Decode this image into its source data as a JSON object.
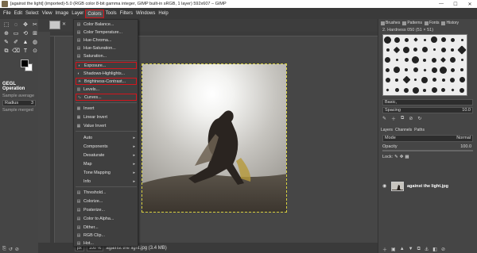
{
  "window": {
    "title": "[against the light] (imported)-5.0 (RGB color 8-bit gamma integer, GIMP built-in sRGB, 1 layer) 592x607 – GIMP",
    "controls": [
      "—",
      "☐",
      "✕"
    ]
  },
  "menubar": {
    "items": [
      "File",
      "Edit",
      "Select",
      "View",
      "Image",
      "Layer",
      "Colors",
      "Tools",
      "Filters",
      "Windows",
      "Help"
    ],
    "active": "Colors"
  },
  "colors_menu": {
    "items": [
      {
        "label": "Color Balance...",
        "icon": "▤",
        "highlighted": false
      },
      {
        "label": "Color Temperature...",
        "icon": "▤",
        "highlighted": false
      },
      {
        "label": "Hue-Chroma...",
        "icon": "▤",
        "highlighted": false
      },
      {
        "label": "Hue-Saturation...",
        "icon": "▤",
        "highlighted": false
      },
      {
        "label": "Saturation...",
        "icon": "▤",
        "highlighted": false
      },
      {
        "label": "Exposure...",
        "icon": "◐",
        "highlighted": true
      },
      {
        "label": "Shadows-Highlights...",
        "icon": "◐",
        "highlighted": false
      },
      {
        "label": "Brightness-Contrast...",
        "icon": "☀",
        "highlighted": true
      },
      {
        "label": "Levels...",
        "icon": "▥",
        "highlighted": false
      },
      {
        "label": "Curves...",
        "icon": "∿",
        "highlighted": true
      },
      {
        "label": "Invert",
        "icon": "▦",
        "highlighted": false
      },
      {
        "label": "Linear Invert",
        "icon": "▦",
        "highlighted": false
      },
      {
        "label": "Value Invert",
        "icon": "▦",
        "highlighted": false
      },
      {
        "label": "Auto",
        "icon": "",
        "submenu": true
      },
      {
        "label": "Components",
        "icon": "",
        "submenu": true
      },
      {
        "label": "Desaturate",
        "icon": "",
        "submenu": true
      },
      {
        "label": "Map",
        "icon": "",
        "submenu": true
      },
      {
        "label": "Tone Mapping",
        "icon": "",
        "submenu": true
      },
      {
        "label": "Info",
        "icon": "",
        "submenu": true
      },
      {
        "label": "Threshold...",
        "icon": "▤",
        "highlighted": false
      },
      {
        "label": "Colorize...",
        "icon": "▤",
        "highlighted": false
      },
      {
        "label": "Posterize...",
        "icon": "▤",
        "highlighted": false
      },
      {
        "label": "Color to Alpha...",
        "icon": "▤",
        "highlighted": false
      },
      {
        "label": "Dither...",
        "icon": "▤",
        "highlighted": false
      },
      {
        "label": "RGB Clip...",
        "icon": "▤",
        "highlighted": false
      },
      {
        "label": "Hot...",
        "icon": "▤",
        "highlighted": false
      }
    ]
  },
  "toolbox": {
    "tools": [
      "⬚",
      "◌",
      "✥",
      "✂",
      "⊕",
      "▭",
      "⟲",
      "⊞",
      "✎",
      "✐",
      "▲",
      "◍",
      "⧉",
      "⌫",
      "T",
      "⊙"
    ],
    "options_title": "GEGL Operation",
    "sample_average": "Sample average",
    "radius_label": "Radius",
    "radius_value": "3",
    "sample_merged": "Sample merged"
  },
  "canvas": {
    "status_unit": "px",
    "zoom": "100 %",
    "status_message": "against the light.jpg (3.4 MB)"
  },
  "dock": {
    "tabs": [
      "Brushes",
      "Patterns",
      "Fonts",
      "History"
    ],
    "brush_title": "2. Hardness 050 (51 × 51)",
    "brush_name": "Basic,",
    "spacing_label": "Spacing",
    "spacing_value": "10.0",
    "layer_tabs": [
      "Layers",
      "Channels",
      "Paths"
    ],
    "mode_label": "Mode",
    "mode_value": "Normal",
    "opacity_label": "Opacity",
    "opacity_value": "100.0",
    "lock_label": "Lock:",
    "layer_name": "against the light.jpg"
  },
  "theme": {
    "highlight_red": "#d4141c",
    "selection_yellow": "#d8d040"
  }
}
